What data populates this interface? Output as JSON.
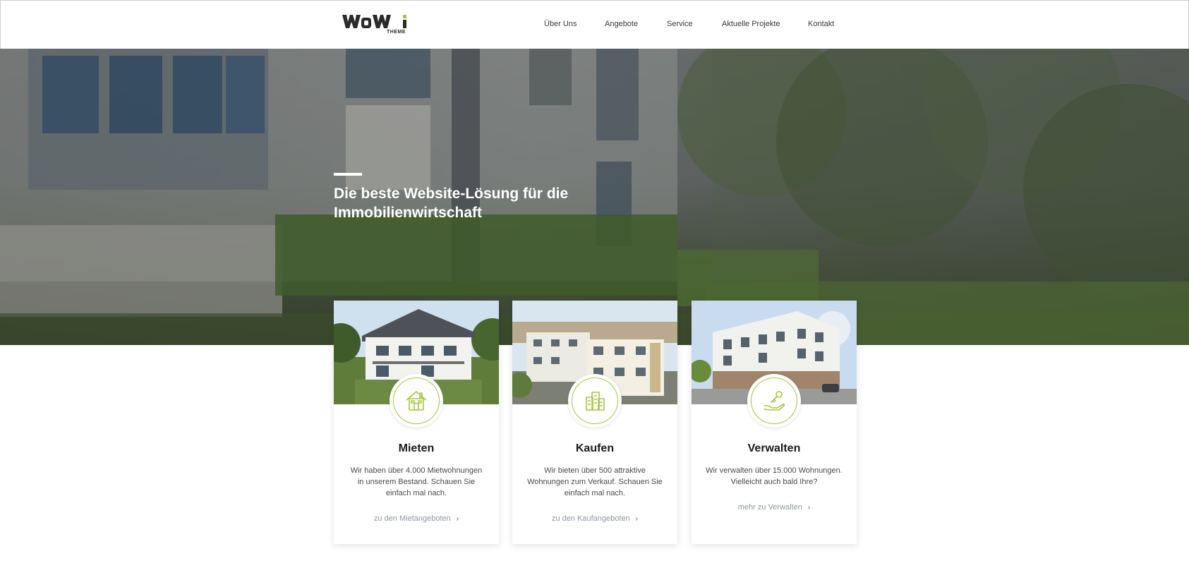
{
  "brand": {
    "logo_text": "wowi",
    "logo_sub": "THEME",
    "accent_color": "#a3c83a"
  },
  "nav": {
    "items": [
      {
        "label": "Über Uns"
      },
      {
        "label": "Angebote"
      },
      {
        "label": "Service"
      },
      {
        "label": "Aktuelle Projekte"
      },
      {
        "label": "Kontakt"
      }
    ]
  },
  "hero": {
    "title_line1": "Die beste Website-Lösung für die",
    "title_line2": "Immobilienwirtschaft"
  },
  "cards": [
    {
      "title": "Mieten",
      "icon": "house-icon",
      "text": "Wir haben über 4.000 Mietwohnungen in unserem Bestand. Schauen Sie einfach mal nach.",
      "link": "zu den Mietangeboten"
    },
    {
      "title": "Kaufen",
      "icon": "buildings-icon",
      "text": "Wir bieten über 500 attraktive Wohnungen zum Verkauf. Schauen Sie einfach mal nach.",
      "link": "zu den Kaufangeboten"
    },
    {
      "title": "Verwalten",
      "icon": "key-hand-icon",
      "text": "Wir verwalten über 15.000 Wohnungen. Vielleicht auch bald Ihre?",
      "link": "mehr zu Verwalten"
    }
  ]
}
